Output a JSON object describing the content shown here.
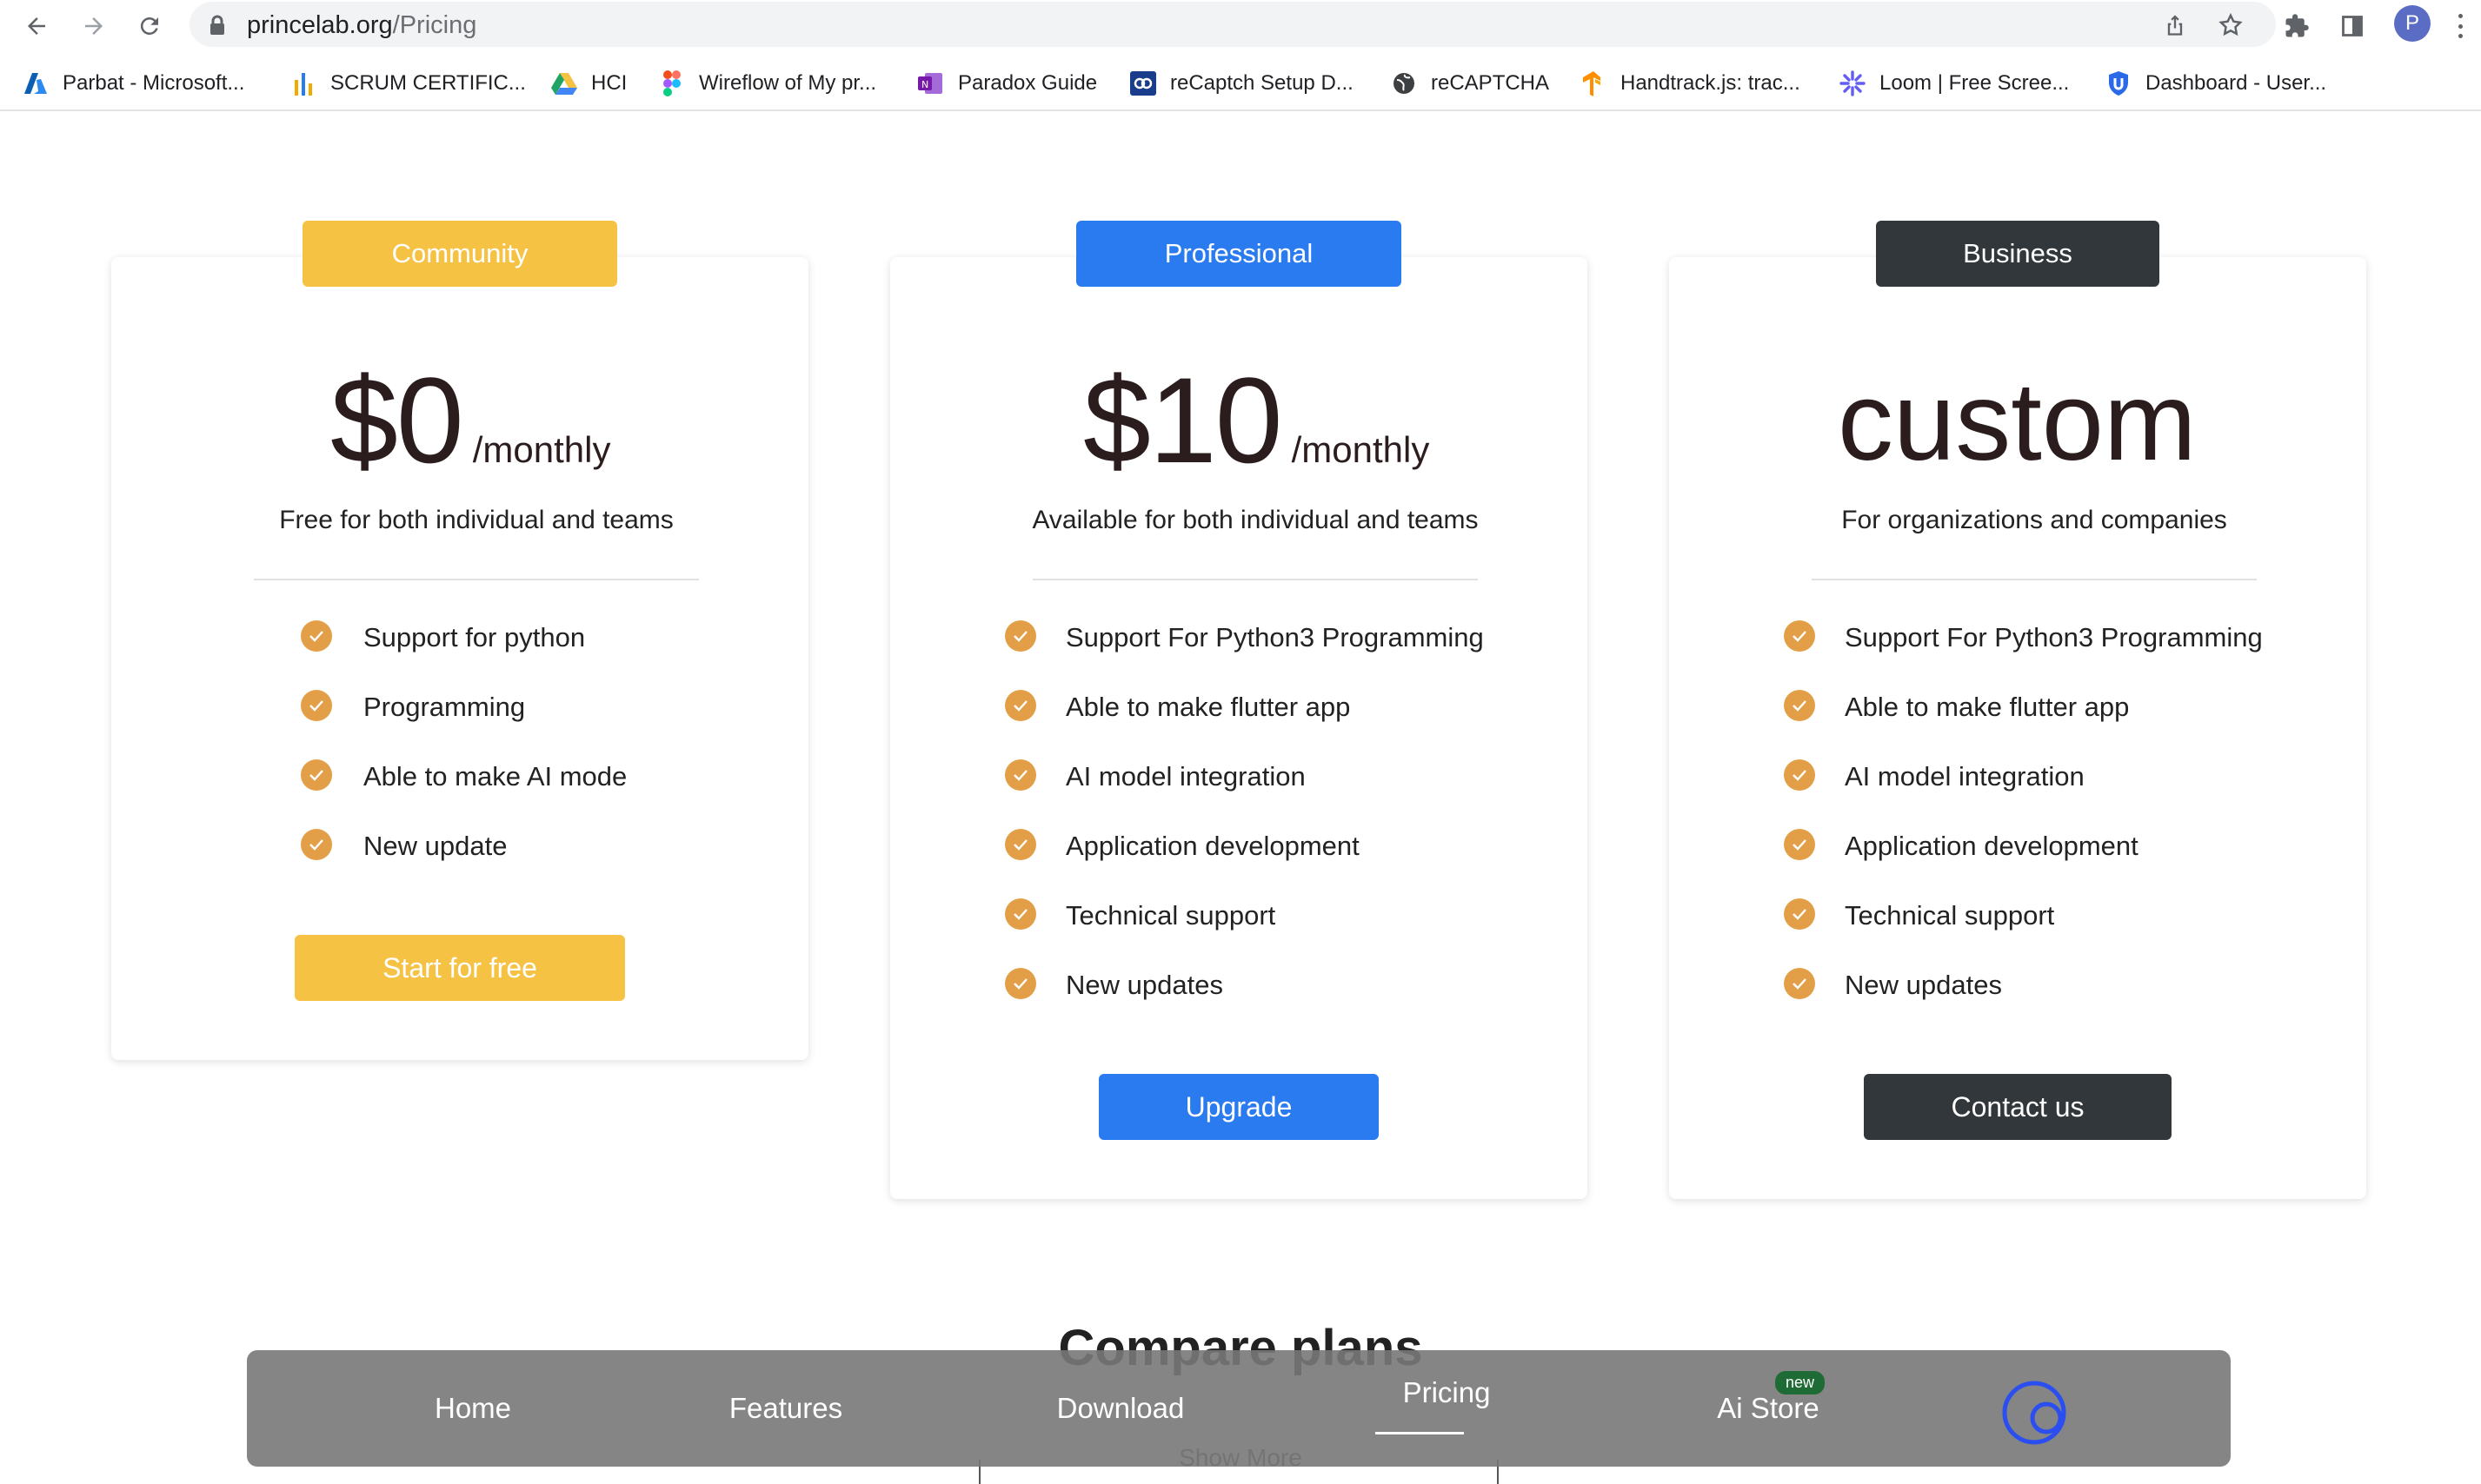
{
  "browser": {
    "url_host": "princelab.org",
    "url_path": "/Pricing",
    "profile_initial": "P"
  },
  "bookmarks": [
    {
      "label": "Parbat - Microsoft...",
      "icon": "azure-icon"
    },
    {
      "label": "SCRUM CERTIFIC...",
      "icon": "bar-chart-icon"
    },
    {
      "label": "HCI",
      "icon": "google-drive-icon"
    },
    {
      "label": "Wireflow of My pr...",
      "icon": "figma-icon"
    },
    {
      "label": "Paradox Guide",
      "icon": "onenote-icon"
    },
    {
      "label": "reCaptch Setup D...",
      "icon": "codeproject-icon"
    },
    {
      "label": "reCAPTCHA",
      "icon": "globe-icon"
    },
    {
      "label": "Handtrack.js: trac...",
      "icon": "tensorflow-icon"
    },
    {
      "label": "Loom | Free Scree...",
      "icon": "loom-icon"
    },
    {
      "label": "Dashboard - User...",
      "icon": "shield-icon"
    }
  ],
  "plans": [
    {
      "tag": "Community",
      "price": "$0",
      "period": "/monthly",
      "description": "Free for both individual and teams",
      "features": [
        "Support for python",
        "Programming",
        "Able to make AI mode",
        "New update"
      ],
      "cta": "Start for free",
      "color": "#f6c244"
    },
    {
      "tag": "Professional",
      "price": "$10",
      "period": "/monthly",
      "description": "Available for both individual and teams",
      "features": [
        "Support For Python3 Programming",
        "Able to make flutter app",
        "AI model integration",
        "Application development",
        "Technical support",
        "New updates"
      ],
      "cta": "Upgrade",
      "color": "#2a7af0"
    },
    {
      "tag": "Business",
      "price": "custom",
      "description": "For organizations and companies",
      "features": [
        "Support For Python3 Programming",
        "Able to make flutter app",
        "AI model integration",
        "Application development",
        "Technical support",
        "New updates"
      ],
      "cta": "Contact us",
      "color": "#32373c"
    }
  ],
  "check_color": "#e39f48",
  "compare": {
    "title": "Compare plans",
    "show_more": "Show More"
  },
  "bottom_nav": {
    "items": [
      "Home",
      "Features",
      "Download",
      "Pricing",
      "Ai Store"
    ],
    "active": "Pricing",
    "badge": "new"
  }
}
